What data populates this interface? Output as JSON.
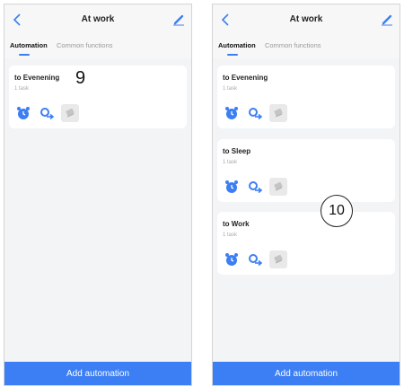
{
  "screens": [
    {
      "header": {
        "title": "At work"
      },
      "tabs": [
        "Automation",
        "Common functions"
      ],
      "cards": [
        {
          "title": "to Evenening",
          "subtitle": "1 task"
        }
      ],
      "annotation": "9",
      "add_button": "Add automation"
    },
    {
      "header": {
        "title": "At work"
      },
      "tabs": [
        "Automation",
        "Common functions"
      ],
      "cards": [
        {
          "title": "to Evenening",
          "subtitle": "1 task"
        },
        {
          "title": "to Sleep",
          "subtitle": "1 task"
        },
        {
          "title": "to Work",
          "subtitle": "1 task"
        }
      ],
      "annotation": "10",
      "add_button": "Add automation"
    }
  ],
  "icons": [
    "back-icon",
    "edit-icon",
    "alarm-clock-icon",
    "location-arrow-icon",
    "scene-card-icon"
  ],
  "colors": {
    "accent": "#3c7ef3",
    "background": "#f3f4f6",
    "card": "#ffffff"
  }
}
